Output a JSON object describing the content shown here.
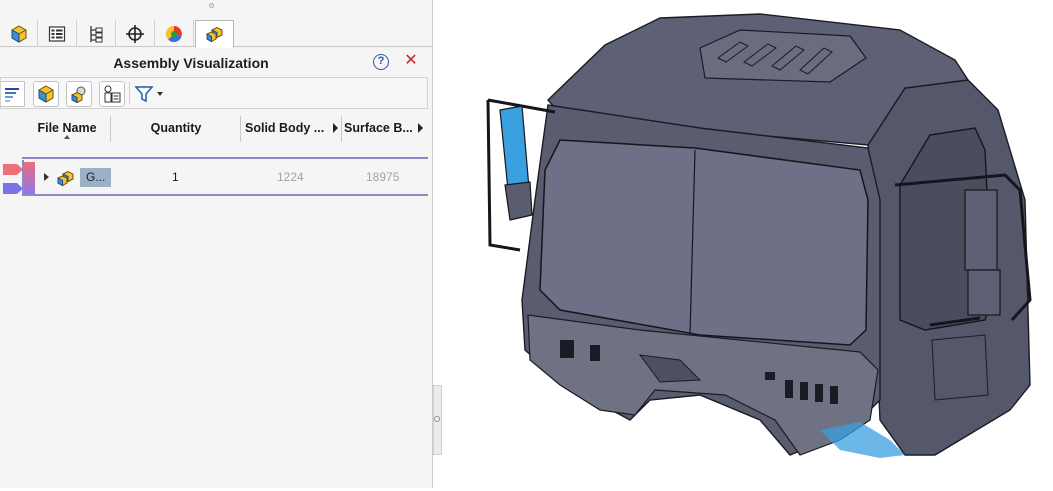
{
  "panel": {
    "title": "Assembly Visualization",
    "tabs": [
      {
        "name": "feature-manager",
        "icon": "part-cube-icon"
      },
      {
        "name": "property-manager",
        "icon": "property-list-icon"
      },
      {
        "name": "configuration-manager",
        "icon": "configuration-icon"
      },
      {
        "name": "dimxpert-manager",
        "icon": "crosshair-icon"
      },
      {
        "name": "display-manager",
        "icon": "color-wheel-icon"
      },
      {
        "name": "assembly-visualization",
        "icon": "assembly-cubes-icon",
        "active": true
      }
    ],
    "toolbar": [
      {
        "name": "gradient-bar-button",
        "icon": "gradient-icon"
      },
      {
        "name": "part-view-button",
        "icon": "part-cube-icon"
      },
      {
        "name": "assembly-view-button",
        "icon": "assembly-icon"
      },
      {
        "name": "properties-button",
        "icon": "properties-icon"
      },
      {
        "name": "filter-dropdown",
        "icon": "filter-icon"
      }
    ]
  },
  "table": {
    "columns": [
      {
        "label": "File Name",
        "sorted": true
      },
      {
        "label": "Quantity"
      },
      {
        "label": "Solid Body ..."
      },
      {
        "label": "Surface B..."
      }
    ],
    "rows": [
      {
        "name": "G...",
        "quantity": "1",
        "solid_bodies": "1224",
        "surface_bodies": "18975"
      }
    ]
  },
  "colors": {
    "range_high": "#ef6f78",
    "range_low": "#7a72e8",
    "selection": "#9cb1c6",
    "model_body": "#5c5f73",
    "highlight": "#3aa0e0"
  }
}
